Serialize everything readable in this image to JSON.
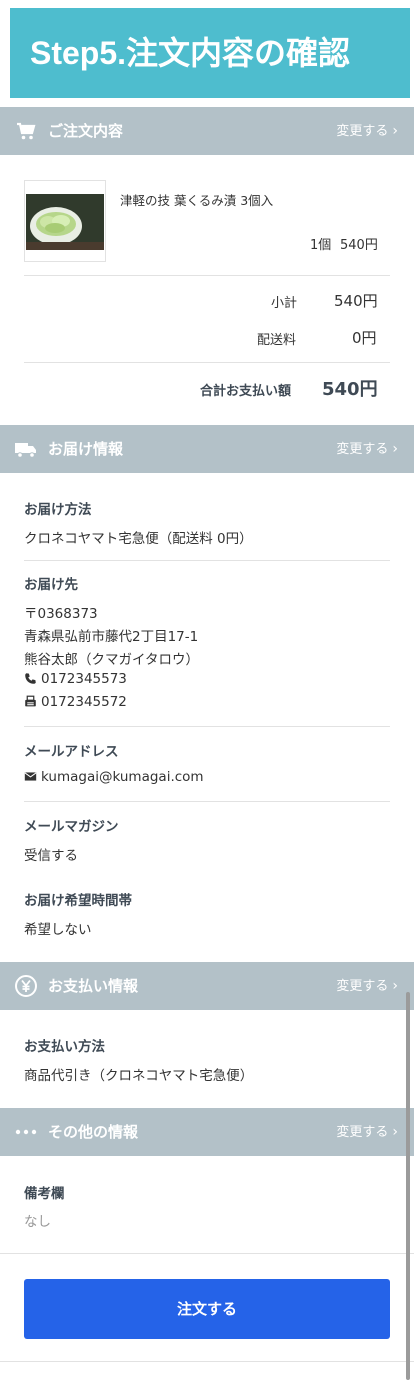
{
  "banner": {
    "title": "Step5.注文内容の確認"
  },
  "sections": {
    "order": {
      "title": "ご注文内容",
      "change": "変更する",
      "icon": "cart-icon"
    },
    "delivery": {
      "title": "お届け情報",
      "change": "変更する",
      "icon": "truck-icon"
    },
    "payment": {
      "title": "お支払い情報",
      "change": "変更する",
      "icon": "yen-icon"
    },
    "other": {
      "title": "その他の情報",
      "change": "変更する",
      "icon": "more-dots-icon"
    }
  },
  "order": {
    "item": {
      "name": "津軽の技 葉くるみ漬 3個入",
      "qty": "1個",
      "price": "540円"
    },
    "subtotal_label": "小計",
    "subtotal": "540円",
    "shipping_label": "配送料",
    "shipping": "0円",
    "total_label": "合計お支払い額",
    "total": "540円"
  },
  "delivery": {
    "method_label": "お届け方法",
    "method": "クロネコヤマト宅急便（配送料 0円）",
    "dest_label": "お届け先",
    "postal": "〒0368373",
    "address": "青森県弘前市藤代2丁目17-1",
    "name": "熊谷太郎（クマガイタロウ）",
    "phone": "0172345573",
    "fax": "0172345572",
    "email_label": "メールアドレス",
    "email": "kumagai@kumagai.com",
    "magazine_label": "メールマガジン",
    "magazine": "受信する",
    "time_label": "お届け希望時間帯",
    "time": "希望しない"
  },
  "payment": {
    "method_label": "お支払い方法",
    "method": "商品代引き（クロネコヤマト宅急便）"
  },
  "other": {
    "note_label": "備考欄",
    "note": "なし"
  },
  "submit": {
    "label": "注文する"
  },
  "colors": {
    "banner": "#4ebdce",
    "header": "#b3c1c8",
    "button": "#2563e8"
  }
}
